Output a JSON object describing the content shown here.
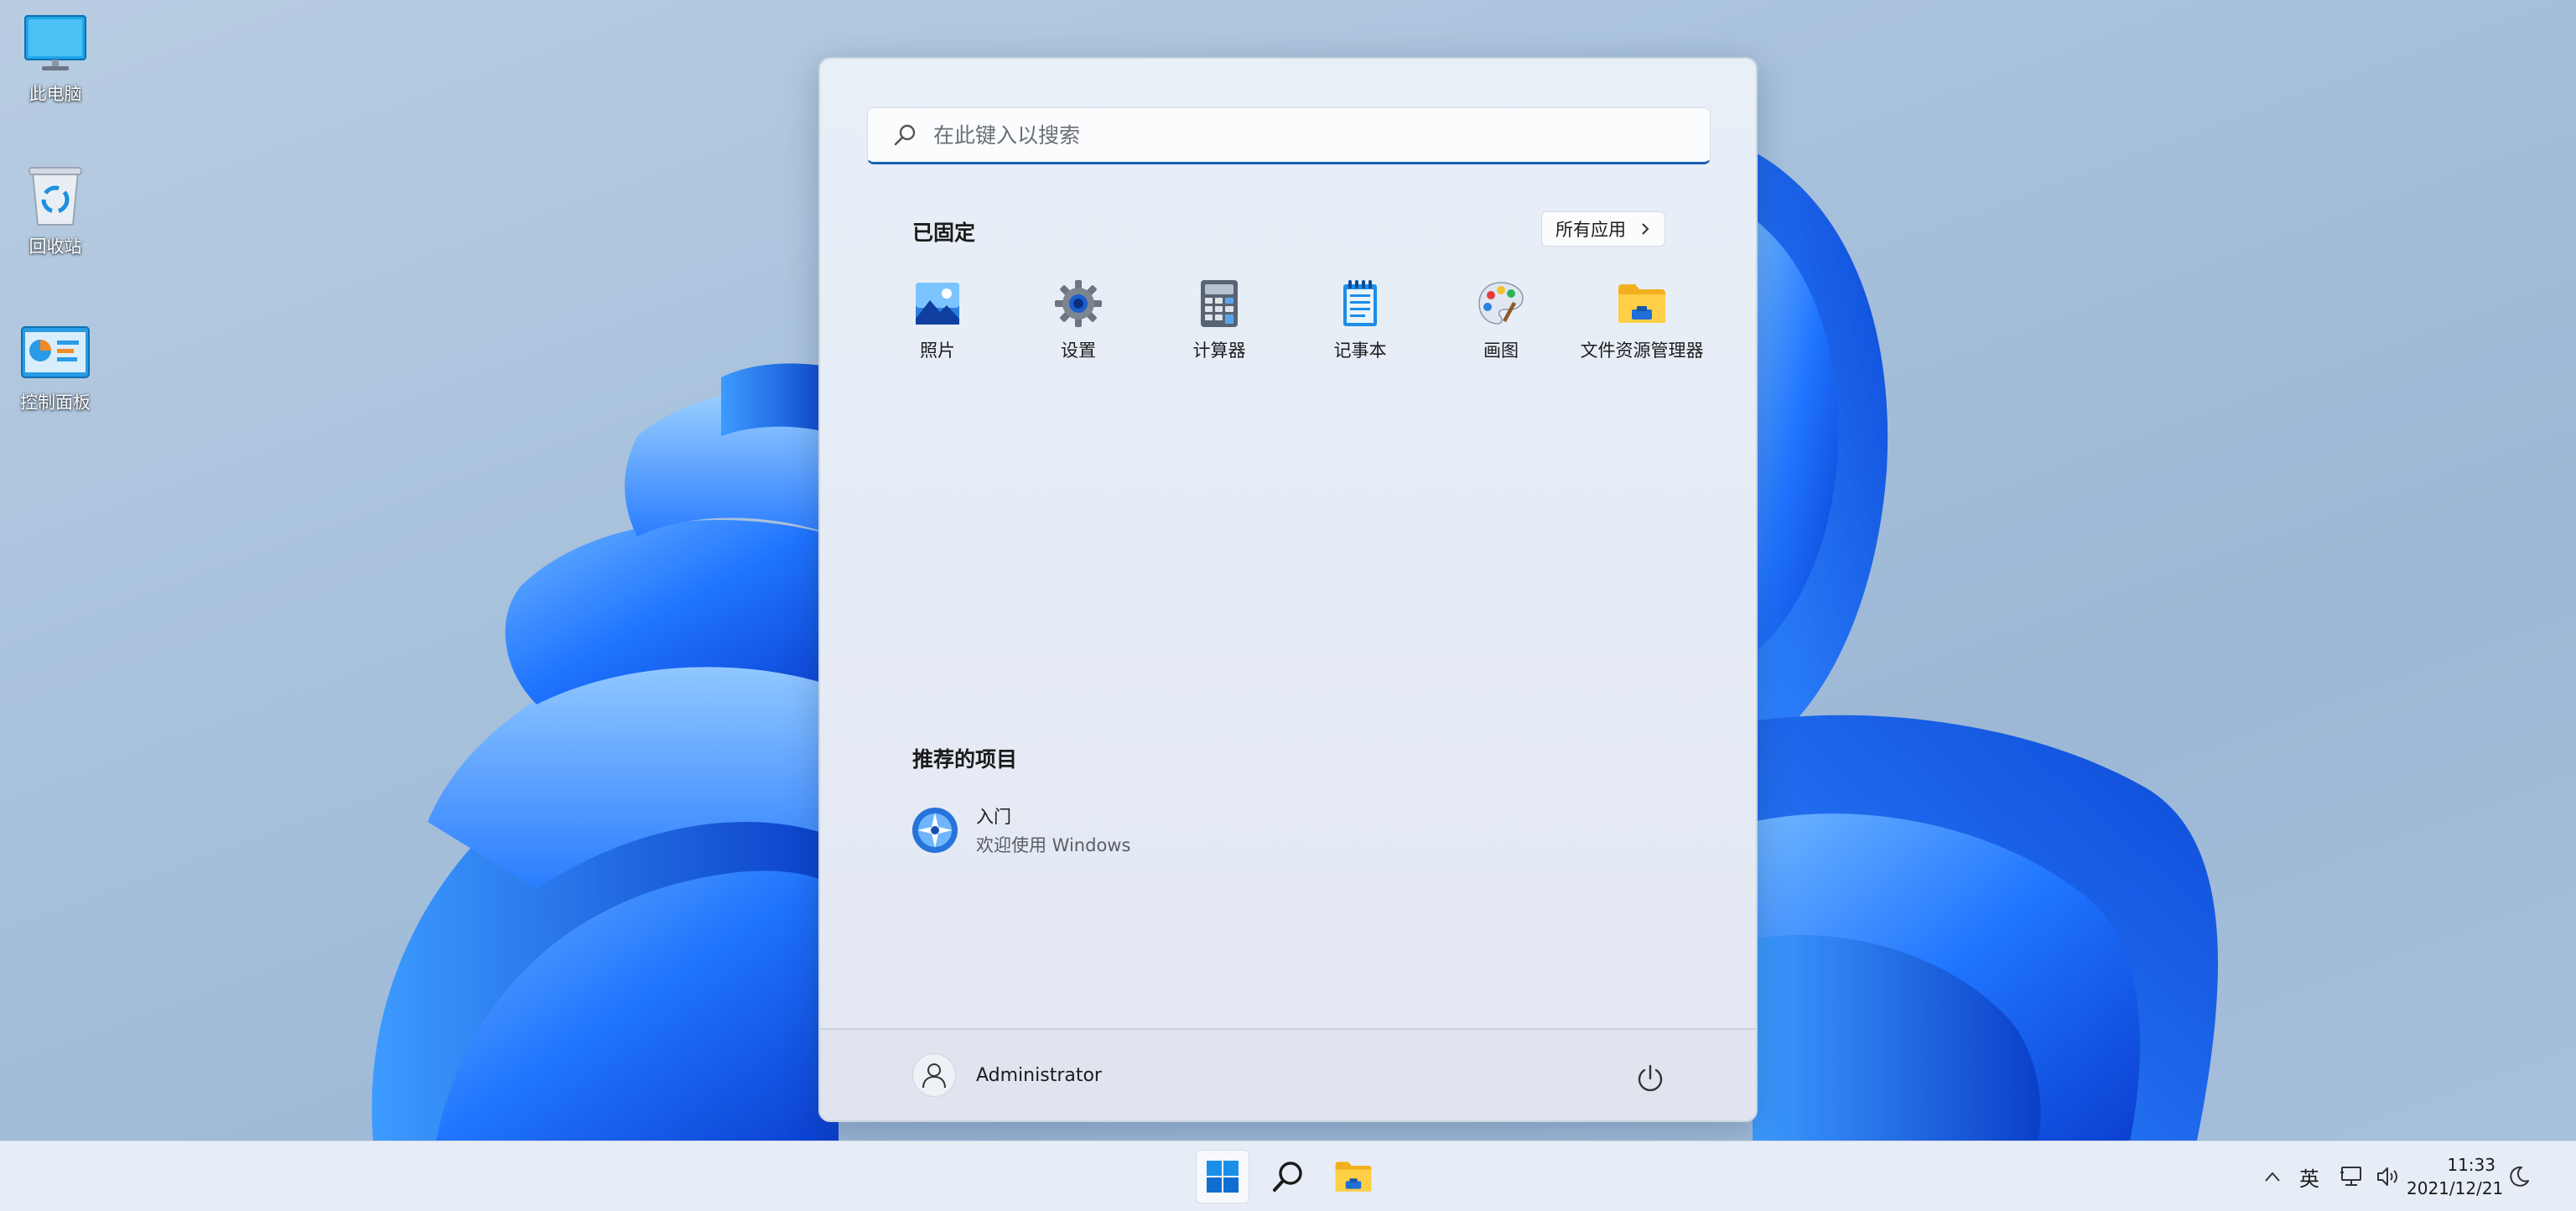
{
  "desktop": {
    "icons": [
      {
        "label": "此电脑",
        "icon": "monitor-icon"
      },
      {
        "label": "回收站",
        "icon": "recycle-bin-icon"
      },
      {
        "label": "控制面板",
        "icon": "control-panel-icon"
      }
    ]
  },
  "start_menu": {
    "search": {
      "placeholder": "在此键入以搜索",
      "icon": "search-icon"
    },
    "pinned": {
      "title": "已固定",
      "all_apps_label": "所有应用",
      "apps": [
        {
          "label": "照片",
          "icon": "photos-icon"
        },
        {
          "label": "设置",
          "icon": "settings-gear-icon"
        },
        {
          "label": "计算器",
          "icon": "calculator-icon"
        },
        {
          "label": "记事本",
          "icon": "notepad-icon"
        },
        {
          "label": "画图",
          "icon": "paint-palette-icon"
        },
        {
          "label": "文件资源管理器",
          "icon": "file-explorer-icon"
        }
      ]
    },
    "recommended": {
      "title": "推荐的项目",
      "items": [
        {
          "title": "入门",
          "subtitle": "欢迎使用 Windows",
          "icon": "get-started-icon"
        }
      ]
    },
    "footer": {
      "user_name": "Administrator",
      "power_icon": "power-icon"
    }
  },
  "taskbar": {
    "buttons": [
      "start-windows-icon",
      "search-icon",
      "file-explorer-icon"
    ],
    "tray": {
      "ime_label": "英",
      "time": "11:33",
      "date": "2021/12/21"
    }
  },
  "colors": {
    "accent": "#1a5fb4",
    "taskbar_bg": "#e7edf6",
    "start_bg": "#e8eef7"
  }
}
